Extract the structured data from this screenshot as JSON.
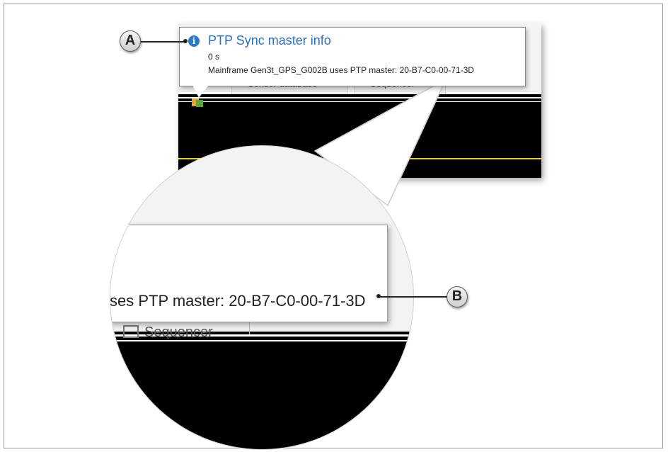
{
  "tooltip": {
    "title": "PTP Sync master info",
    "time": "0 s",
    "message": "Mainframe Gen3t_GPS_G002B uses PTP master: 20-B7-C0-00-71-3D",
    "icon": "info-icon"
  },
  "tabs": [
    "Sensor database",
    "Sequencer"
  ],
  "magnified": {
    "text": "ses PTP master: 20-B7-C0-00-71-3D",
    "tab": "Sequencer"
  },
  "callouts": {
    "a": "A",
    "b": "B"
  },
  "colors": {
    "title": "#2a6fc0",
    "info": "#2a79c7",
    "signal": "#e8d600",
    "background": "#000000"
  }
}
